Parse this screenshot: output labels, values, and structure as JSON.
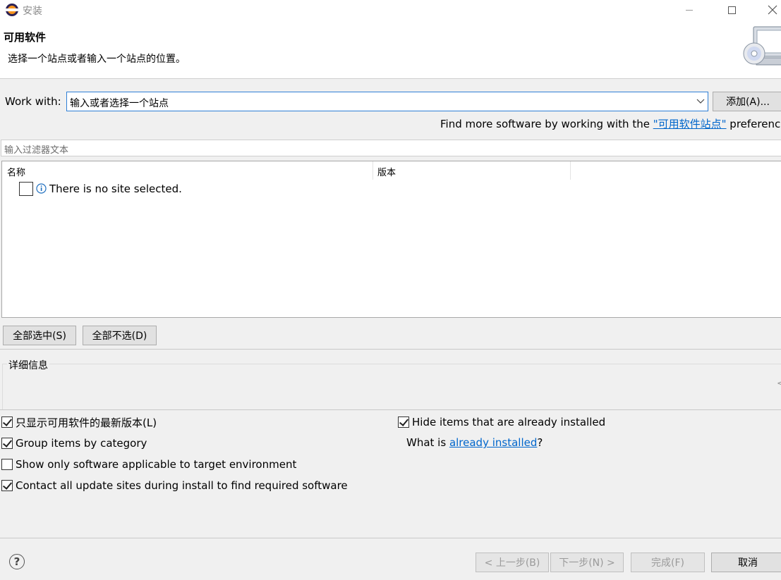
{
  "window": {
    "title": "安装"
  },
  "header": {
    "title": "可用软件",
    "description": "选择一个站点或者输入一个站点的位置。",
    "image_icon": "cd-computer-icon"
  },
  "work_with": {
    "label": "Work with:",
    "value": "输入或者选择一个站点",
    "add_button": "添加(A)..."
  },
  "find_more": {
    "prefix": "Find more software by working with the ",
    "link": "\"可用软件站点\"",
    "suffix": " preferences"
  },
  "filter": {
    "placeholder": "输入过滤器文本"
  },
  "table": {
    "columns": [
      "名称",
      "版本"
    ],
    "rows": [
      {
        "text": "There is no site selected.",
        "icon": "info-icon",
        "checked": false
      }
    ]
  },
  "selection_buttons": {
    "select_all": "全部选中(S)",
    "deselect_all": "全部不选(D)"
  },
  "details": {
    "label": "详细信息"
  },
  "options": {
    "latest_only": {
      "label": "只显示可用软件的最新版本(L)",
      "checked": true
    },
    "group_by_category": {
      "label": "Group items by category",
      "checked": true
    },
    "target_env_only": {
      "label": "Show only software applicable to target environment",
      "checked": false
    },
    "contact_all_sites": {
      "label": "Contact all update sites during install to find required software",
      "checked": true
    },
    "hide_installed": {
      "label": "Hide items that are already installed",
      "checked": true
    },
    "what_is_prefix": "What is ",
    "what_is_link": "already installed",
    "what_is_suffix": "?"
  },
  "footer": {
    "help_icon": "help-icon",
    "back": "< 上一步(B)",
    "next": "下一步(N) >",
    "finish": "完成(F)",
    "cancel": "取消"
  }
}
